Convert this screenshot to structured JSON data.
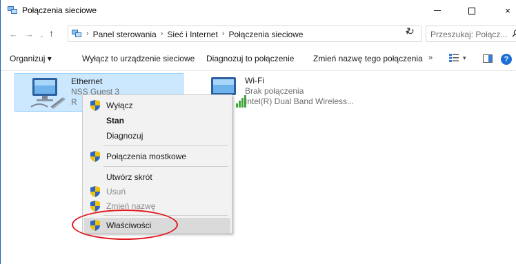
{
  "window": {
    "title": "Połączenia sieciowe",
    "icon": "network-connections-icon",
    "controls": {
      "minimize": "minimize-icon",
      "maximize": "maximize-icon",
      "close": "×"
    }
  },
  "address": {
    "crumbs": [
      "Panel sterowania",
      "Sieć i Internet",
      "Połączenia sieciowe"
    ],
    "search_placeholder": "Przeszukaj: Połącz..."
  },
  "toolbar": {
    "organize": "Organizuj ▾",
    "disable": "Wyłącz to urządzenie sieciowe",
    "diagnose": "Diagnozuj to połączenie",
    "rename": "Zmień nazwę tego połączenia",
    "more": "»",
    "help": "?"
  },
  "connections": [
    {
      "name": "Ethernet",
      "line2": "NSS Guest 3",
      "line3": "R",
      "selected": true
    },
    {
      "name": "Wi-Fi",
      "line2": "Brak połączenia",
      "line3": "Intel(R) Dual Band Wireless..."
    }
  ],
  "context_menu": {
    "items": [
      {
        "label": "Wyłącz",
        "shield": true
      },
      {
        "label": "Stan",
        "bold": true
      },
      {
        "label": "Diagnozuj"
      },
      {
        "label": "Połączenia mostkowe",
        "shield": true
      },
      {
        "label": "Utwórz skrót"
      },
      {
        "label": "Usuń",
        "shield": true,
        "disabled": true
      },
      {
        "label": "Zmień nazwę",
        "shield": true,
        "disabled": true
      },
      {
        "label": "Właściwości",
        "shield": true,
        "highlighted": true
      }
    ]
  },
  "colors": {
    "selection_bg": "#cce8ff",
    "annotation": "#e0181e",
    "accent": "#1c6fd4"
  }
}
